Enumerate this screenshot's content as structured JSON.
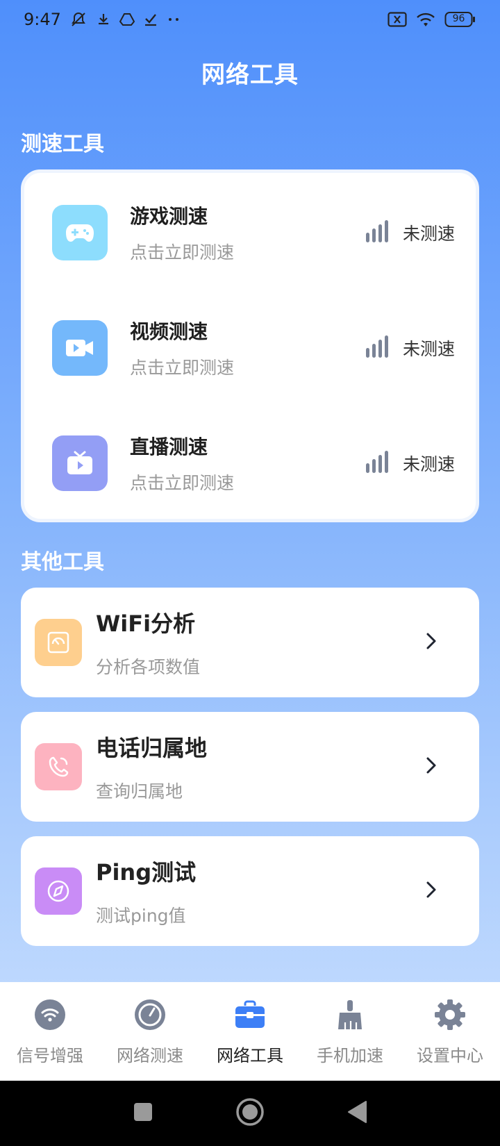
{
  "status_bar": {
    "time": "9:47",
    "battery": "96",
    "icons": [
      "mute-icon",
      "download-icon",
      "drive-icon",
      "check-icon",
      "more-dots-icon",
      "sim-x-icon",
      "wifi-icon",
      "battery-icon"
    ]
  },
  "header": {
    "title": "网络工具"
  },
  "speed_section": {
    "title": "测速工具",
    "items": [
      {
        "name": "游戏测速",
        "sub": "点击立即测速",
        "status": "未测速",
        "icon": "gamepad-icon",
        "color": "#8DDDFD"
      },
      {
        "name": "视频测速",
        "sub": "点击立即测速",
        "status": "未测速",
        "icon": "video-camera-icon",
        "color": "#74B8FB"
      },
      {
        "name": "直播测速",
        "sub": "点击立即测速",
        "status": "未测速",
        "icon": "tv-play-icon",
        "color": "#939EF5"
      }
    ]
  },
  "other_section": {
    "title": "其他工具",
    "items": [
      {
        "name": "WiFi分析",
        "sub": "分析各项数值",
        "icon": "gauge-icon",
        "color": "#FECF8E"
      },
      {
        "name": "电话归属地",
        "sub": "查询归属地",
        "icon": "phone-icon",
        "color": "#FDB3C0"
      },
      {
        "name": "Ping测试",
        "sub": "测试ping值",
        "icon": "compass-icon",
        "color": "#C98CF6"
      }
    ]
  },
  "bottom_nav": {
    "items": [
      {
        "label": "信号增强",
        "icon": "wifi-signal-icon",
        "active": false
      },
      {
        "label": "网络测速",
        "icon": "speedometer-icon",
        "active": false
      },
      {
        "label": "网络工具",
        "icon": "toolbox-icon",
        "active": true
      },
      {
        "label": "手机加速",
        "icon": "broom-icon",
        "active": false
      },
      {
        "label": "设置中心",
        "icon": "gear-icon",
        "active": false
      }
    ]
  },
  "colors": {
    "accent": "#4F8FFB",
    "nav_active": "#3D7FF6",
    "nav_inactive": "#7A8396"
  }
}
